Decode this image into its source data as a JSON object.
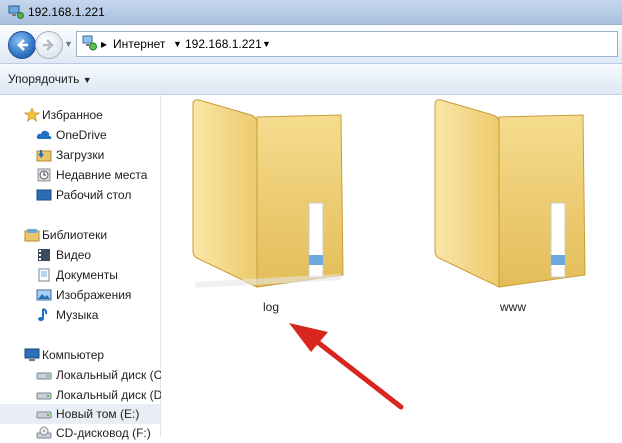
{
  "window": {
    "title": "192.168.1.221"
  },
  "address": {
    "crumbs": [
      "Интернет",
      "192.168.1.221"
    ]
  },
  "toolbar": {
    "organize_label": "Упорядочить"
  },
  "sidebar": {
    "favorites": {
      "header": "Избранное",
      "items": [
        "OneDrive",
        "Загрузки",
        "Недавние места",
        "Рабочий стол"
      ]
    },
    "libraries": {
      "header": "Библиотеки",
      "items": [
        "Видео",
        "Документы",
        "Изображения",
        "Музыка"
      ]
    },
    "computer": {
      "header": "Компьютер",
      "items": [
        "Локальный диск (C",
        "Локальный диск (D",
        "Новый том (E:)",
        "CD-дисковод (F:)"
      ]
    }
  },
  "folders": [
    {
      "name": "log"
    },
    {
      "name": "www"
    }
  ],
  "colors": {
    "annotation_arrow": "#d7261e",
    "folder_yellow": "#f3d27a",
    "selection": "#e9eef4"
  }
}
